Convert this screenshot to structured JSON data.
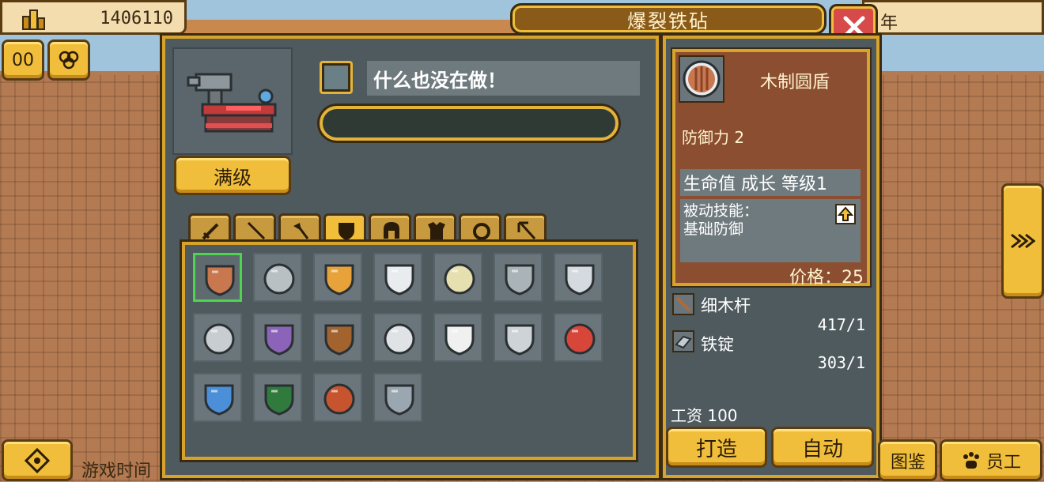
{
  "hud": {
    "money": "1406110",
    "top_right_partial": "年",
    "pause_label": "00",
    "game_time_label": "游戏时间",
    "codex_label": "图鉴",
    "staff_label": "员工"
  },
  "window": {
    "title": "爆裂铁砧"
  },
  "anvil": {
    "level_label": "满级",
    "status_text": "什么也没在做！",
    "progress": 0
  },
  "tabs": [
    "sword-icon",
    "spear-icon",
    "axe-icon",
    "shield-icon",
    "helmet-icon",
    "armor-icon",
    "ring-icon",
    "bow-icon"
  ],
  "active_tab": 3,
  "shields": [
    {
      "name": "wooden-round-shield",
      "color": "#c9774f",
      "selected": true
    },
    {
      "name": "iron-round-shield",
      "color": "#b9c0c4"
    },
    {
      "name": "heraldic-shield",
      "color": "#e8a23a"
    },
    {
      "name": "white-kite-shield",
      "color": "#e9ecee"
    },
    {
      "name": "gold-trim-shield",
      "color": "#e6dfb0"
    },
    {
      "name": "spiked-buckler",
      "color": "#aab3b8"
    },
    {
      "name": "steel-half-shield",
      "color": "#d4dadf"
    },
    {
      "name": "tower-shield",
      "color": "#c8cdd1"
    },
    {
      "name": "purple-round-shield",
      "color": "#8b63b8"
    },
    {
      "name": "bronze-spiked-shield",
      "color": "#a3632f"
    },
    {
      "name": "silver-ornate-shield",
      "color": "#dfe3e6"
    },
    {
      "name": "cross-shield",
      "color": "#f0f0f0"
    },
    {
      "name": "winged-shield",
      "color": "#cdd3d7"
    },
    {
      "name": "lion-shield",
      "color": "#d8463a"
    },
    {
      "name": "sapphire-shield",
      "color": "#4b8fd9"
    },
    {
      "name": "dragon-shield",
      "color": "#2f7a3c"
    },
    {
      "name": "ruby-tower-shield",
      "color": "#c5542f"
    },
    {
      "name": "cross-emblem-shield",
      "color": "#9aa7b0"
    }
  ],
  "detail": {
    "item_name": "木制圆盾",
    "defense": "防御力 2",
    "stat_row": "生命值 成长 等级1",
    "passive_title": "被动技能：",
    "passive_name": "基础防御",
    "price": "价格：25",
    "materials": [
      {
        "icon": "wooden-stick-icon",
        "name": "细木杆",
        "count": "417/1"
      },
      {
        "icon": "iron-ingot-icon",
        "name": "铁锭",
        "count": "303/1"
      }
    ],
    "wage": "工资 100",
    "craft_label": "打造",
    "auto_label": "自动"
  }
}
